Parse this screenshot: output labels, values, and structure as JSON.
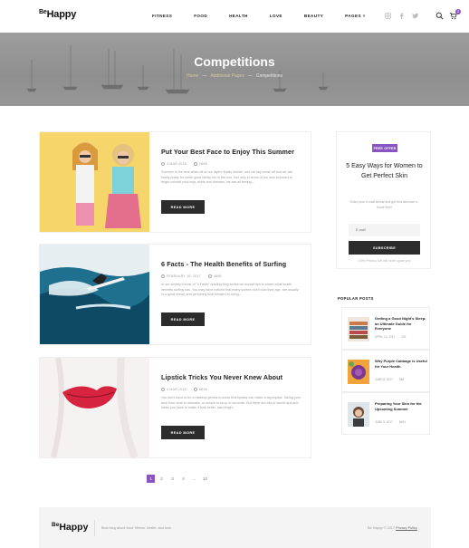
{
  "header": {
    "logo_prefix": "Be",
    "logo_main": "Happy",
    "nav": [
      "FITNESS",
      "FOOD",
      "HEALTH",
      "LOVE",
      "BEAUTY",
      "PAGES ˅"
    ],
    "cart_count": "0"
  },
  "hero": {
    "title": "Competitions",
    "breadcrumb": [
      "Home",
      "Additional Pages",
      "Competitions"
    ],
    "separator": "—"
  },
  "posts": [
    {
      "title": "Put Your Best Face to Enjoy This Summer",
      "date": "4 MAR 2016",
      "views": "2668",
      "excerpt": "Summer is the time when all of our layers finally shelter, and we say come off and we are finally ready for some good family fun in the sun. Not only in terms of our skin exposed to bright colored pool toys, skirts and dresses, we are all feeling...",
      "button": "READ MORE"
    },
    {
      "title": "6 Facts - The Health Benefits of Surfing",
      "date": "FEBRUARY 18, 2017",
      "views": "4898",
      "excerpt": "In our society's book of \"4 Facts\" reading blog series we accept tips to share what health benefits surfing has. You may have noticed that many surfers don't look their age, are usually in a good mood, and genuinely look forward to being...",
      "button": "READ MORE"
    },
    {
      "title": "Lipstick Tricks You Never Knew About",
      "date": "4 MAR 2016",
      "views": "6838",
      "excerpt": "You don't have to be a makeup genius to know that lipstick can make a big impact. Taking your face from drab to dramatic, or simple to sexy, in seconds. But there are lots of secret tips and ideas you have to make it look better, last longer...",
      "button": "READ MORE"
    }
  ],
  "pagination": [
    "1",
    "2",
    "3",
    "4",
    "...",
    "12"
  ],
  "promo": {
    "badge": "FREE OFFER",
    "title": "5 Easy Ways for Women to Get Perfect Skin",
    "description": "Enter your e-mail below and get this skincare e-Book free!",
    "email_placeholder": "E-mail",
    "button": "SUBSCRIBE",
    "note": "100% Privacy. We will never spam you!"
  },
  "popular": {
    "heading": "POPULAR POSTS",
    "items": [
      {
        "title": "Getting a Good Night's Sleep: an Ultimate Guide for Everyone",
        "date": "APRIL 14, 2017",
        "views": "331"
      },
      {
        "title": "Why Purple Cabbage is Useful for Your Health",
        "date": "JUNE 8, 2017",
        "views": "558"
      },
      {
        "title": "Preparing Your Skin for the Upcoming Summer",
        "date": "JUNE 9, 2017",
        "views": "6494"
      }
    ]
  },
  "footer": {
    "logo_prefix": "Be",
    "logo_main": "Happy",
    "tagline": "Best blog about food, fitness, health, and love.",
    "copyright": "Be Happy © 2017",
    "privacy": "Privacy Policy"
  },
  "colors": {
    "accent": "#8a55c1",
    "dark_button": "#2c2c2c",
    "hero_gray": "#979797"
  }
}
